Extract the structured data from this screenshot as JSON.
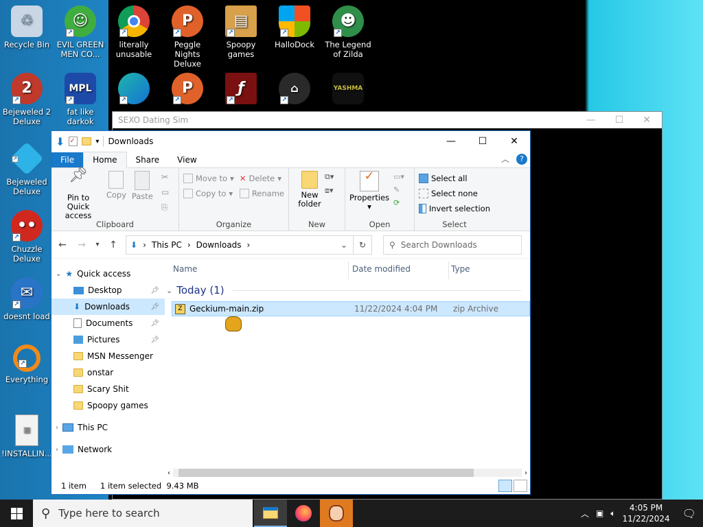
{
  "desktop": {
    "icons": [
      {
        "label": "Recycle Bin",
        "color": "#c8d6e5"
      },
      {
        "label": "EVIL GREEN MEN CO...",
        "color": "#3fae3f"
      },
      {
        "label": "literally unusable",
        "color": "#db4437"
      },
      {
        "label": "Peggle Nights Deluxe",
        "color": "#e0622a"
      },
      {
        "label": "Spoopy games",
        "color": "#d8a04a"
      },
      {
        "label": "HalloDock",
        "color": "#2a7bd6"
      },
      {
        "label": "The Legend of Zilda",
        "color": "#2f8f4a"
      },
      {
        "label": "Bejeweled 2 Deluxe",
        "color": "#c0392b"
      },
      {
        "label": "fat like darkok",
        "color": "#1d4aa8"
      },
      {
        "label": "Bejeweled Deluxe",
        "color": "#2db3e8"
      },
      {
        "label": "Chuzzle Deluxe",
        "color": "#d0281e"
      },
      {
        "label": "doesnt load",
        "color": "#2a74c8"
      },
      {
        "label": "Everything",
        "color": "#f08a1a"
      },
      {
        "label": "!INSTALLIN...",
        "color": "#e8e8e8"
      }
    ],
    "partial_icons": [
      "Microsoft Edge",
      "Peggle World",
      "Flash Player",
      "RDP",
      "Yashma"
    ]
  },
  "back_window": {
    "title": "SEXO Dating Sim"
  },
  "explorer": {
    "title": "Downloads",
    "tabs": {
      "file": "File",
      "home": "Home",
      "share": "Share",
      "view": "View"
    },
    "ribbon": {
      "clipboard": {
        "pin": "Pin to Quick access",
        "copy": "Copy",
        "paste": "Paste",
        "label": "Clipboard"
      },
      "organize": {
        "move_to": "Move to",
        "copy_to": "Copy to",
        "delete": "Delete",
        "rename": "Rename",
        "label": "Organize"
      },
      "new": {
        "new_folder": "New folder",
        "label": "New"
      },
      "open": {
        "properties": "Properties",
        "label": "Open"
      },
      "select": {
        "select_all": "Select all",
        "select_none": "Select none",
        "invert": "Invert selection",
        "label": "Select"
      }
    },
    "address": {
      "root": "This PC",
      "current": "Downloads",
      "search_placeholder": "Search Downloads"
    },
    "nav": {
      "quick_access": "Quick access",
      "items": [
        "Desktop",
        "Downloads",
        "Documents",
        "Pictures",
        "MSN Messenger",
        "onstar",
        "Scary Shit",
        "Spoopy games"
      ],
      "this_pc": "This PC",
      "network": "Network"
    },
    "columns": {
      "name": "Name",
      "date": "Date modified",
      "type": "Type"
    },
    "group": "Today (1)",
    "file": {
      "name": "Geckium-main.zip",
      "date": "11/22/2024 4:04 PM",
      "type": "zip Archive"
    },
    "status": {
      "count": "1 item",
      "selected": "1 item selected",
      "size": "9.43 MB"
    }
  },
  "taskbar": {
    "search_placeholder": "Type here to search",
    "time": "4:05 PM",
    "date": "11/22/2024"
  }
}
